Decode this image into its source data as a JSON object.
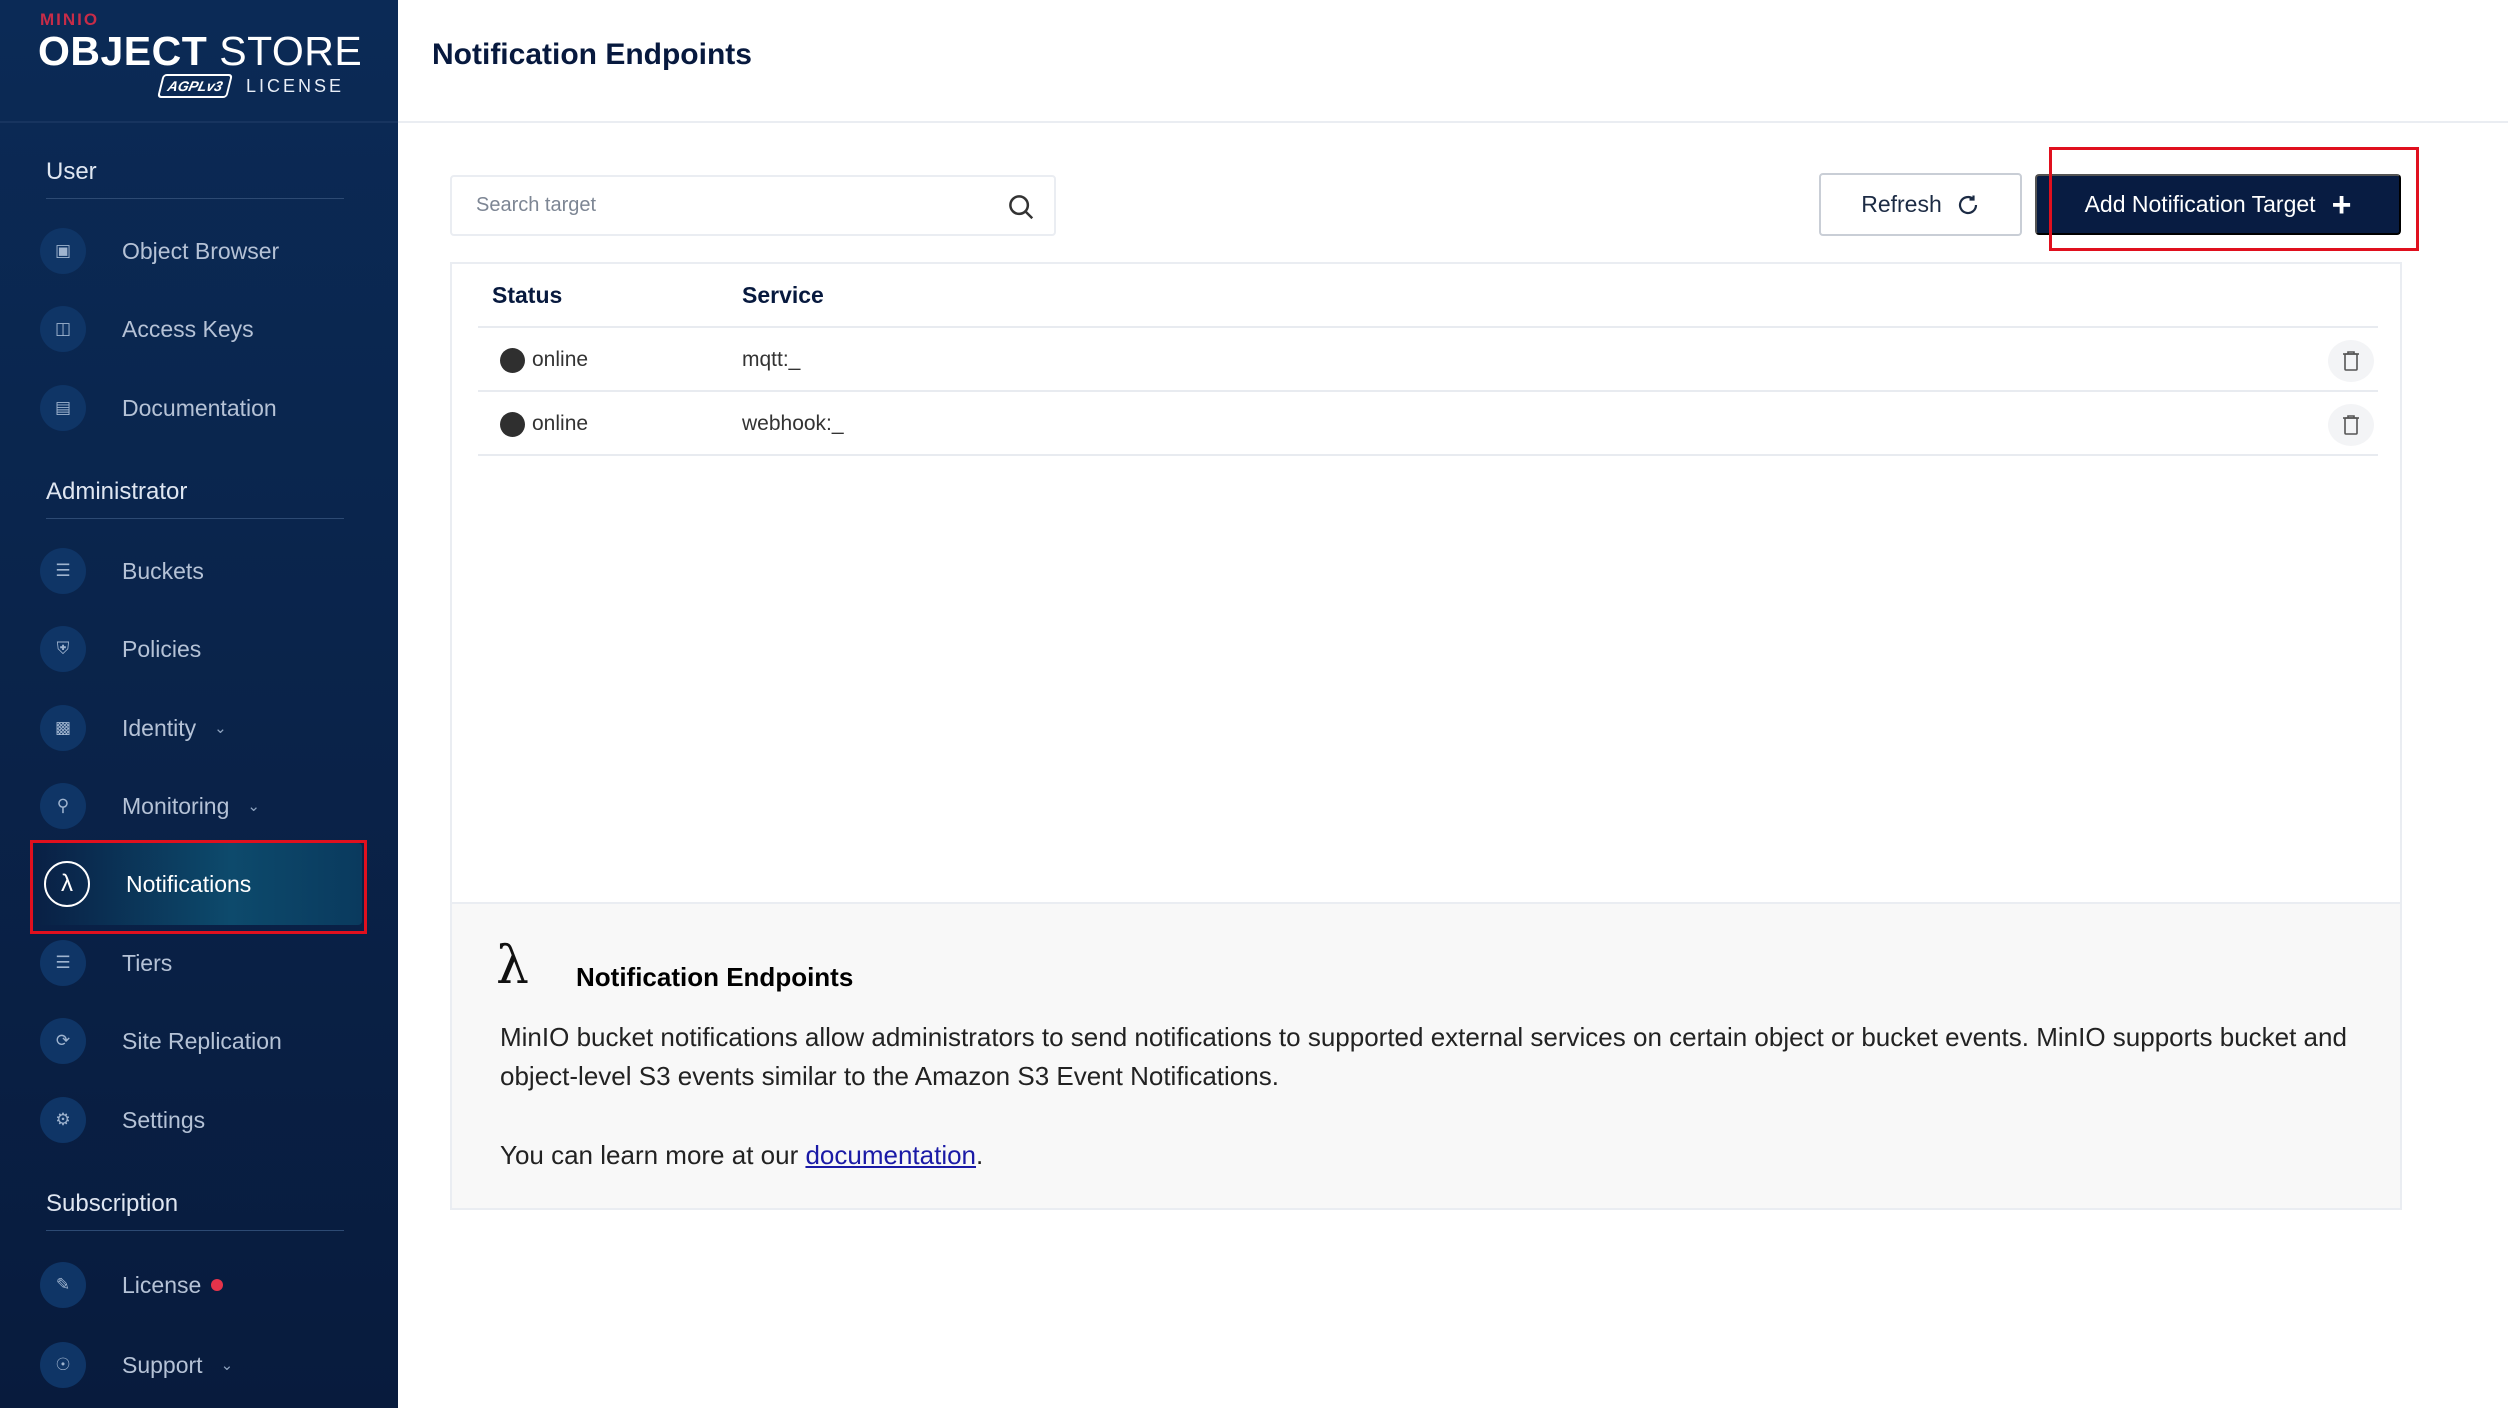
{
  "brand": {
    "minio": "MINIO",
    "product_bold": "OBJECT",
    "product_thin": "STORE",
    "badge": "AGPLv3",
    "license": "LICENSE"
  },
  "sidebar": {
    "sections": {
      "user": "User",
      "administrator": "Administrator",
      "subscription": "Subscription"
    },
    "items": [
      {
        "label": "Object Browser",
        "icon": "object-browser-icon"
      },
      {
        "label": "Access Keys",
        "icon": "access-keys-icon"
      },
      {
        "label": "Documentation",
        "icon": "documentation-icon"
      },
      {
        "label": "Buckets",
        "icon": "buckets-icon"
      },
      {
        "label": "Policies",
        "icon": "policies-icon"
      },
      {
        "label": "Identity",
        "icon": "identity-icon",
        "expandable": true
      },
      {
        "label": "Monitoring",
        "icon": "monitoring-icon",
        "expandable": true
      },
      {
        "label": "Notifications",
        "icon": "lambda-icon",
        "active": true
      },
      {
        "label": "Tiers",
        "icon": "tiers-icon"
      },
      {
        "label": "Site Replication",
        "icon": "site-replication-icon"
      },
      {
        "label": "Settings",
        "icon": "settings-icon"
      },
      {
        "label": "License",
        "icon": "license-icon",
        "badge_color": "#e5334a"
      },
      {
        "label": "Support",
        "icon": "support-icon",
        "expandable": true
      }
    ]
  },
  "header": {
    "title": "Notification Endpoints"
  },
  "toolbar": {
    "search_placeholder": "Search target",
    "refresh_label": "Refresh",
    "add_label": "Add Notification Target"
  },
  "table": {
    "columns": [
      "Status",
      "Service"
    ],
    "rows": [
      {
        "status": "online",
        "service": "mqtt:_"
      },
      {
        "status": "online",
        "service": "webhook:_"
      }
    ]
  },
  "info": {
    "title": "Notification Endpoints",
    "body": "MinIO bucket notifications allow administrators to send notifications to supported external services on certain object or bucket events. MinIO supports bucket and object-level S3 events similar to the Amazon S3 Event Notifications.",
    "more_prefix": "You can learn more at our ",
    "link_text": "documentation",
    "more_suffix": "."
  },
  "colors": {
    "sidebar_bg": "#0a244b",
    "primary_button": "#081c42",
    "highlight": "#e0101e",
    "status_dot": "#2f2f2f",
    "license_badge": "#e5334a"
  }
}
